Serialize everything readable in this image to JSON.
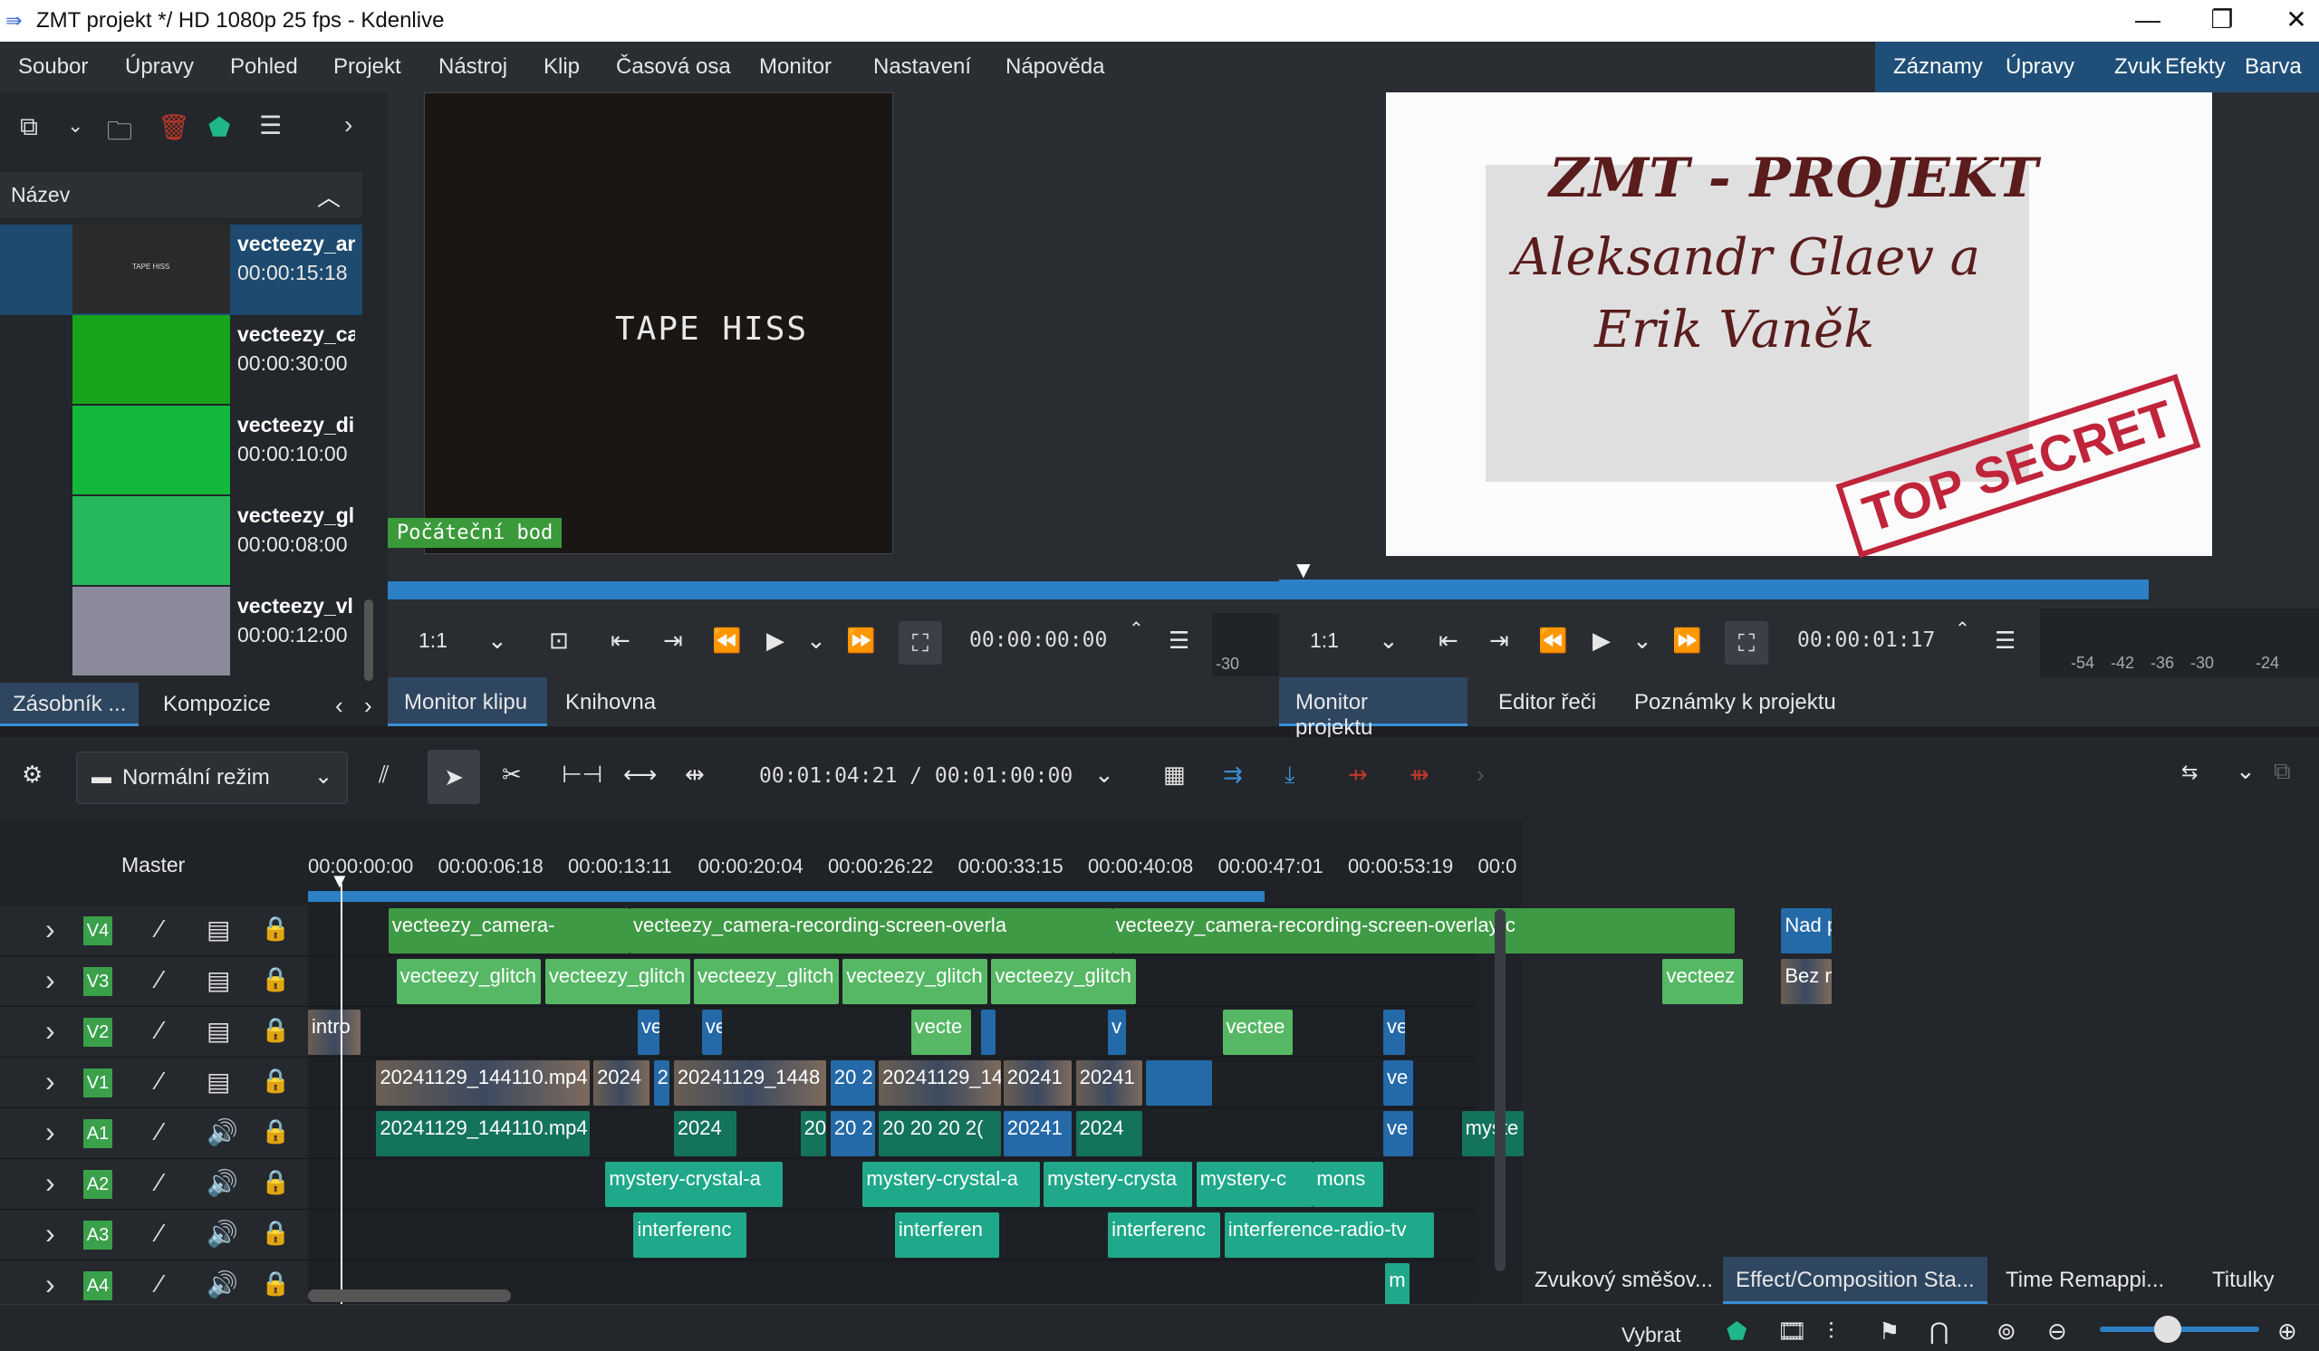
{
  "window": {
    "title": "ZMT projekt */ HD 1080p 25 fps - Kdenlive",
    "minimize": "—",
    "maximize": "❐",
    "close": "✕"
  },
  "menu": [
    "Soubor",
    "Úpravy",
    "Pohled",
    "Projekt",
    "Nástroj",
    "Klip",
    "Časová osa",
    "Monitor",
    "Nastavení",
    "Nápověda"
  ],
  "workspaces": [
    "Záznamy",
    "Úpravy",
    "Zvuk",
    "Efekty",
    "Barva"
  ],
  "bin": {
    "column_header": "Název",
    "clips": [
      {
        "name": "vecteezy_ar",
        "duration": "00:00:15:18",
        "thumb": "#2a2a2a",
        "thumb_text": "TAPE HISS"
      },
      {
        "name": "vecteezy_ca",
        "duration": "00:00:30:00",
        "thumb": "#17a31c",
        "thumb_text": ""
      },
      {
        "name": "vecteezy_di",
        "duration": "00:00:10:00",
        "thumb": "#12b83a",
        "thumb_text": ""
      },
      {
        "name": "vecteezy_gl",
        "duration": "00:00:08:00",
        "thumb": "#27b85c",
        "thumb_text": ""
      },
      {
        "name": "vecteezy_vl",
        "duration": "00:00:12:00",
        "thumb": "#8a8a9a",
        "thumb_text": ""
      }
    ],
    "tabs": [
      "Zásobník ...",
      "Kompozice"
    ]
  },
  "clip_monitor": {
    "overlay_text": "TAPE HISS",
    "marker_label": "Počáteční bod",
    "zoom": "1:1",
    "timecode": "00:00:00:00",
    "vu_label": "-30",
    "tabs": [
      "Monitor klipu",
      "Knihovna"
    ]
  },
  "project_monitor": {
    "title_line1": "ZMT - PROJEKT",
    "title_line2": "Aleksandr Glaev a",
    "title_line3": "Erik Vaněk",
    "stamp": "TOP SECRET",
    "zoom": "1:1",
    "timecode": "00:00:01:17",
    "vu_labels": [
      "-54",
      "-42",
      "-36",
      "-30",
      "-24"
    ],
    "tabs": [
      "Monitor projektu",
      "Editor řeči",
      "Poznámky k projektu"
    ]
  },
  "timeline_toolbar": {
    "mode": "Normální režim",
    "timecode": "00:01:04:21 / 00:01:00:00"
  },
  "timeline": {
    "master_label": "Master",
    "ruler": [
      "00:00:00:00",
      "00:00:06:18",
      "00:00:13:11",
      "00:00:20:04",
      "00:00:26:22",
      "00:00:33:15",
      "00:00:40:08",
      "00:00:47:01",
      "00:00:53:19",
      "00:0"
    ],
    "tracks": [
      {
        "label": "V4",
        "type": "video"
      },
      {
        "label": "V3",
        "type": "video"
      },
      {
        "label": "V2",
        "type": "video"
      },
      {
        "label": "V1",
        "type": "video"
      },
      {
        "label": "A1",
        "type": "audio"
      },
      {
        "label": "A2",
        "type": "audio"
      },
      {
        "label": "A3",
        "type": "audio"
      },
      {
        "label": "A4",
        "type": "audio"
      }
    ],
    "clips": [
      {
        "track": 0,
        "text": "vecteezy_camera-",
        "start": 0.04,
        "end": 0.16,
        "style": "v-green"
      },
      {
        "track": 0,
        "text": "vecteezy_camera-recording-screen-overla",
        "start": 0.16,
        "end": 0.4,
        "style": "v-green"
      },
      {
        "track": 0,
        "text": "vecteezy_camera-recording-screen-overlay-c",
        "start": 0.4,
        "end": 0.71,
        "style": "v-green"
      },
      {
        "track": 0,
        "text": "Nad p",
        "start": 0.733,
        "end": 0.758,
        "style": "v-blue"
      },
      {
        "track": 1,
        "text": "vecteezy_glitch",
        "start": 0.044,
        "end": 0.116,
        "style": "v-lt"
      },
      {
        "track": 1,
        "text": "vecteezy_glitch",
        "start": 0.118,
        "end": 0.19,
        "style": "v-lt"
      },
      {
        "track": 1,
        "text": "vecteezy_glitch",
        "start": 0.192,
        "end": 0.264,
        "style": "v-lt"
      },
      {
        "track": 1,
        "text": "vecteezy_glitch",
        "start": 0.266,
        "end": 0.338,
        "style": "v-lt"
      },
      {
        "track": 1,
        "text": "vecteezy_glitch",
        "start": 0.34,
        "end": 0.412,
        "style": "v-lt"
      },
      {
        "track": 1,
        "text": "vecteez",
        "start": 0.674,
        "end": 0.714,
        "style": "v-lt"
      },
      {
        "track": 1,
        "text": "Bez n",
        "start": 0.733,
        "end": 0.758,
        "style": "v-thumb"
      },
      {
        "track": 2,
        "text": "intro",
        "start": 0.0,
        "end": 0.026,
        "style": "v-thumb"
      },
      {
        "track": 2,
        "text": "ve",
        "start": 0.164,
        "end": 0.175,
        "style": "v-blue"
      },
      {
        "track": 2,
        "text": "ve",
        "start": 0.196,
        "end": 0.206,
        "style": "v-blue"
      },
      {
        "track": 2,
        "text": "vecte",
        "start": 0.3,
        "end": 0.33,
        "style": "v-lt"
      },
      {
        "track": 2,
        "text": "",
        "start": 0.335,
        "end": 0.342,
        "style": "v-blue"
      },
      {
        "track": 2,
        "text": "v",
        "start": 0.398,
        "end": 0.407,
        "style": "v-blue"
      },
      {
        "track": 2,
        "text": "vectee",
        "start": 0.455,
        "end": 0.49,
        "style": "v-lt"
      },
      {
        "track": 2,
        "text": "ve",
        "start": 0.535,
        "end": 0.546,
        "style": "v-blue"
      },
      {
        "track": 3,
        "text": "20241129_144110.mp4",
        "start": 0.034,
        "end": 0.14,
        "style": "v-thumb"
      },
      {
        "track": 3,
        "text": "2024",
        "start": 0.142,
        "end": 0.17,
        "style": "v-thumb"
      },
      {
        "track": 3,
        "text": "2(",
        "start": 0.172,
        "end": 0.18,
        "style": "v-blue"
      },
      {
        "track": 3,
        "text": "20241129_1448",
        "start": 0.182,
        "end": 0.258,
        "style": "v-thumb"
      },
      {
        "track": 3,
        "text": "20 2",
        "start": 0.26,
        "end": 0.282,
        "style": "v-blue"
      },
      {
        "track": 3,
        "text": "20241129_145",
        "start": 0.284,
        "end": 0.345,
        "style": "v-thumb"
      },
      {
        "track": 3,
        "text": "20241",
        "start": 0.346,
        "end": 0.38,
        "style": "v-thumb"
      },
      {
        "track": 3,
        "text": "20241",
        "start": 0.382,
        "end": 0.415,
        "style": "v-thumb"
      },
      {
        "track": 3,
        "text": "",
        "start": 0.417,
        "end": 0.45,
        "style": "v-blue"
      },
      {
        "track": 3,
        "text": "ve",
        "start": 0.535,
        "end": 0.55,
        "style": "v-blue"
      },
      {
        "track": 4,
        "text": "20241129_144110.mp4",
        "start": 0.034,
        "end": 0.14,
        "style": "a-teal"
      },
      {
        "track": 4,
        "text": "2024",
        "start": 0.182,
        "end": 0.213,
        "style": "a-teal"
      },
      {
        "track": 4,
        "text": "20",
        "start": 0.245,
        "end": 0.258,
        "style": "a-teal"
      },
      {
        "track": 4,
        "text": "20 2",
        "start": 0.26,
        "end": 0.282,
        "style": "v-blue"
      },
      {
        "track": 4,
        "text": "20 20 20 2(",
        "start": 0.284,
        "end": 0.345,
        "style": "a-teal"
      },
      {
        "track": 4,
        "text": "20241",
        "start": 0.346,
        "end": 0.38,
        "style": "v-blue"
      },
      {
        "track": 4,
        "text": "2024",
        "start": 0.382,
        "end": 0.415,
        "style": "a-teal"
      },
      {
        "track": 4,
        "text": "ve",
        "start": 0.535,
        "end": 0.55,
        "style": "v-blue"
      },
      {
        "track": 4,
        "text": "myste",
        "start": 0.574,
        "end": 0.605,
        "style": "a-teal"
      },
      {
        "track": 5,
        "text": "mystery-crystal-a",
        "start": 0.148,
        "end": 0.236,
        "style": "a-lt"
      },
      {
        "track": 5,
        "text": "mystery-crystal-a",
        "start": 0.276,
        "end": 0.364,
        "style": "a-lt"
      },
      {
        "track": 5,
        "text": "mystery-crysta",
        "start": 0.366,
        "end": 0.44,
        "style": "a-lt"
      },
      {
        "track": 5,
        "text": "mystery-c",
        "start": 0.442,
        "end": 0.5,
        "style": "a-lt"
      },
      {
        "track": 5,
        "text": "mons",
        "start": 0.5,
        "end": 0.535,
        "style": "a-lt"
      },
      {
        "track": 6,
        "text": "interferenc",
        "start": 0.162,
        "end": 0.218,
        "style": "a-lt"
      },
      {
        "track": 6,
        "text": "interferen",
        "start": 0.292,
        "end": 0.344,
        "style": "a-lt"
      },
      {
        "track": 6,
        "text": "interferenc",
        "start": 0.398,
        "end": 0.454,
        "style": "a-lt"
      },
      {
        "track": 6,
        "text": "interference-radio-tv",
        "start": 0.456,
        "end": 0.56,
        "style": "a-lt"
      },
      {
        "track": 7,
        "text": "m",
        "start": 0.536,
        "end": 0.548,
        "style": "a-lt"
      }
    ]
  },
  "bottom_tabs": [
    "Zvukový směšov...",
    "Effect/Composition Sta...",
    "Time Remappi...",
    "Titulky"
  ],
  "status": {
    "select_label": "Vybrat"
  }
}
